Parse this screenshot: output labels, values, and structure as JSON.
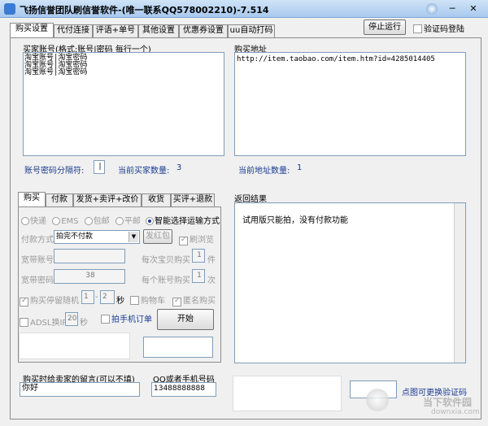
{
  "window": {
    "title": "飞扬信誉团队刷信誉软件-(唯一联系QQ578002210)-7.514",
    "buttons": {
      "minimize": "─",
      "close": "✕"
    }
  },
  "top_tabs": [
    "购买设置",
    "代付连接",
    "评语+单号",
    "其他设置",
    "优惠券设置",
    "uu自动打码"
  ],
  "stop_button": "停止运行",
  "captcha_login": "验证码登陆",
  "buyer_accounts": {
    "label": "买家账号(格式:账号|密码 每行一个)",
    "lines": [
      "淘宝账号|淘宝密码",
      "淘宝账号|淘宝密码",
      "淘宝账号|淘宝密码"
    ],
    "separator_label": "账号密码分隔符:",
    "separator_value": "|",
    "count_label": "当前买家数量:",
    "count_value": "3"
  },
  "buy_url": {
    "label": "购买地址",
    "value": "http://item.taobao.com/item.htm?id=4285014405",
    "count_label": "当前地址数量:",
    "count_value": "1"
  },
  "sub_tabs": [
    "购买",
    "付款",
    "发货+卖评+改价",
    "收货",
    "买评+退款"
  ],
  "shipping": {
    "options": [
      "快递",
      "EMS",
      "包邮",
      "平邮",
      "智能选择运输方式"
    ]
  },
  "payment": {
    "label": "付款方式",
    "value": "拍完不付款",
    "red_packet": "发红包",
    "browse": "刷浏览"
  },
  "broadband": {
    "account_label": "宽带账号",
    "password_label": "宽带密码",
    "password_value": "38",
    "per_item_label": "每次宝贝购买",
    "per_item_value": "1",
    "per_item_unit": "件",
    "per_account_label": "每个账号购买",
    "per_account_value": "1",
    "per_account_unit": "次"
  },
  "delay": {
    "label": "购买停留随机",
    "from": "1",
    "to": "2",
    "unit": "秒",
    "cart": "购物车",
    "anonymous": "匿名购买"
  },
  "adsl": {
    "label": "ADSL换IP",
    "value": "20",
    "unit": "秒",
    "mobile_order": "拍手机订单",
    "start": "开始"
  },
  "results": {
    "label": "返回结果",
    "text": "试用版只能拍，没有付款功能"
  },
  "message": {
    "label": "购买时给卖家的留言(可以不填)",
    "value": "你好"
  },
  "phone": {
    "label": "QQ或者手机号码",
    "value": "13488888888"
  },
  "captcha_hint": "点图可更换验证码",
  "watermark": {
    "text": "当下软件园",
    "sub": "downxia.com"
  }
}
